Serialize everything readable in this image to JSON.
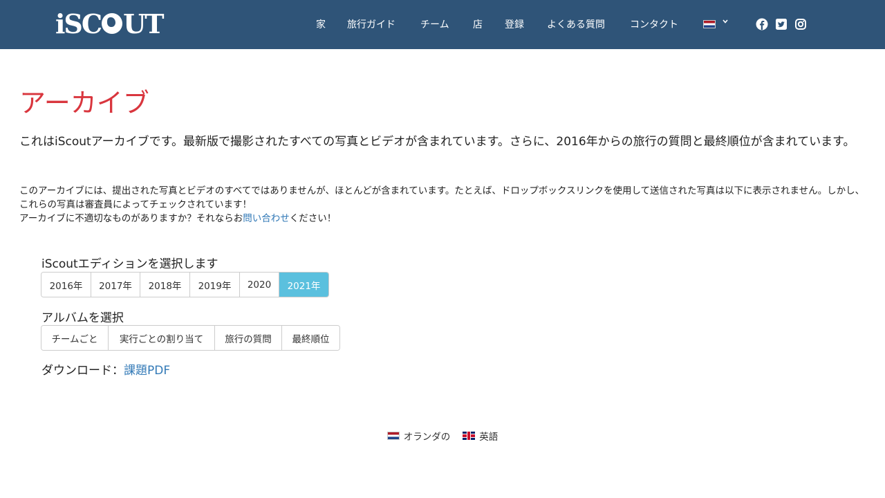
{
  "header": {
    "logo_text": "iSCOUT",
    "nav": [
      "家",
      "旅行ガイド",
      "チーム",
      "店",
      "登録",
      "よくある質問",
      "コンタクト"
    ],
    "icons": [
      "flag-nl-icon",
      "chevron-down-icon",
      "facebook-icon",
      "twitter-icon",
      "instagram-icon"
    ]
  },
  "page": {
    "title": "アーカイブ",
    "intro": "これはiScoutアーカイブです。最新版で撮影されたすべての写真とビデオが含まれています。さらに、2016年からの旅行の質問と最終順位が含まれています。",
    "note_line1": "このアーカイブには、提出された写真とビデオのすべてではありませんが、ほとんどが含まれています。たとえば、ドロップボックスリンクを使用して送信された写真は以下に表示されません。しかし、これらの写真は審査員によってチェックされています！",
    "note_line2_prefix": "アーカイブに不適切なものがありますか？それならお",
    "note_link": "問い合わせ",
    "note_line2_suffix": "ください！"
  },
  "edition": {
    "label": "iScoutエディションを選択します",
    "options": [
      "2016年",
      "2017年",
      "2018年",
      "2019年",
      "2020",
      "2021年"
    ],
    "active": "2021年"
  },
  "album": {
    "label": "アルバムを選択",
    "options": [
      "チームごと",
      "実行ごとの割り当て",
      "旅行の質問",
      "最終順位"
    ]
  },
  "download": {
    "label": "ダウンロード：",
    "link": "課題PDF"
  },
  "footer": {
    "languages": [
      "オランダの",
      "英語"
    ]
  },
  "colors": {
    "header_bg": "#2f5478",
    "title": "#d9363e",
    "active_button": "#5bc0de",
    "link": "#337ab7"
  }
}
